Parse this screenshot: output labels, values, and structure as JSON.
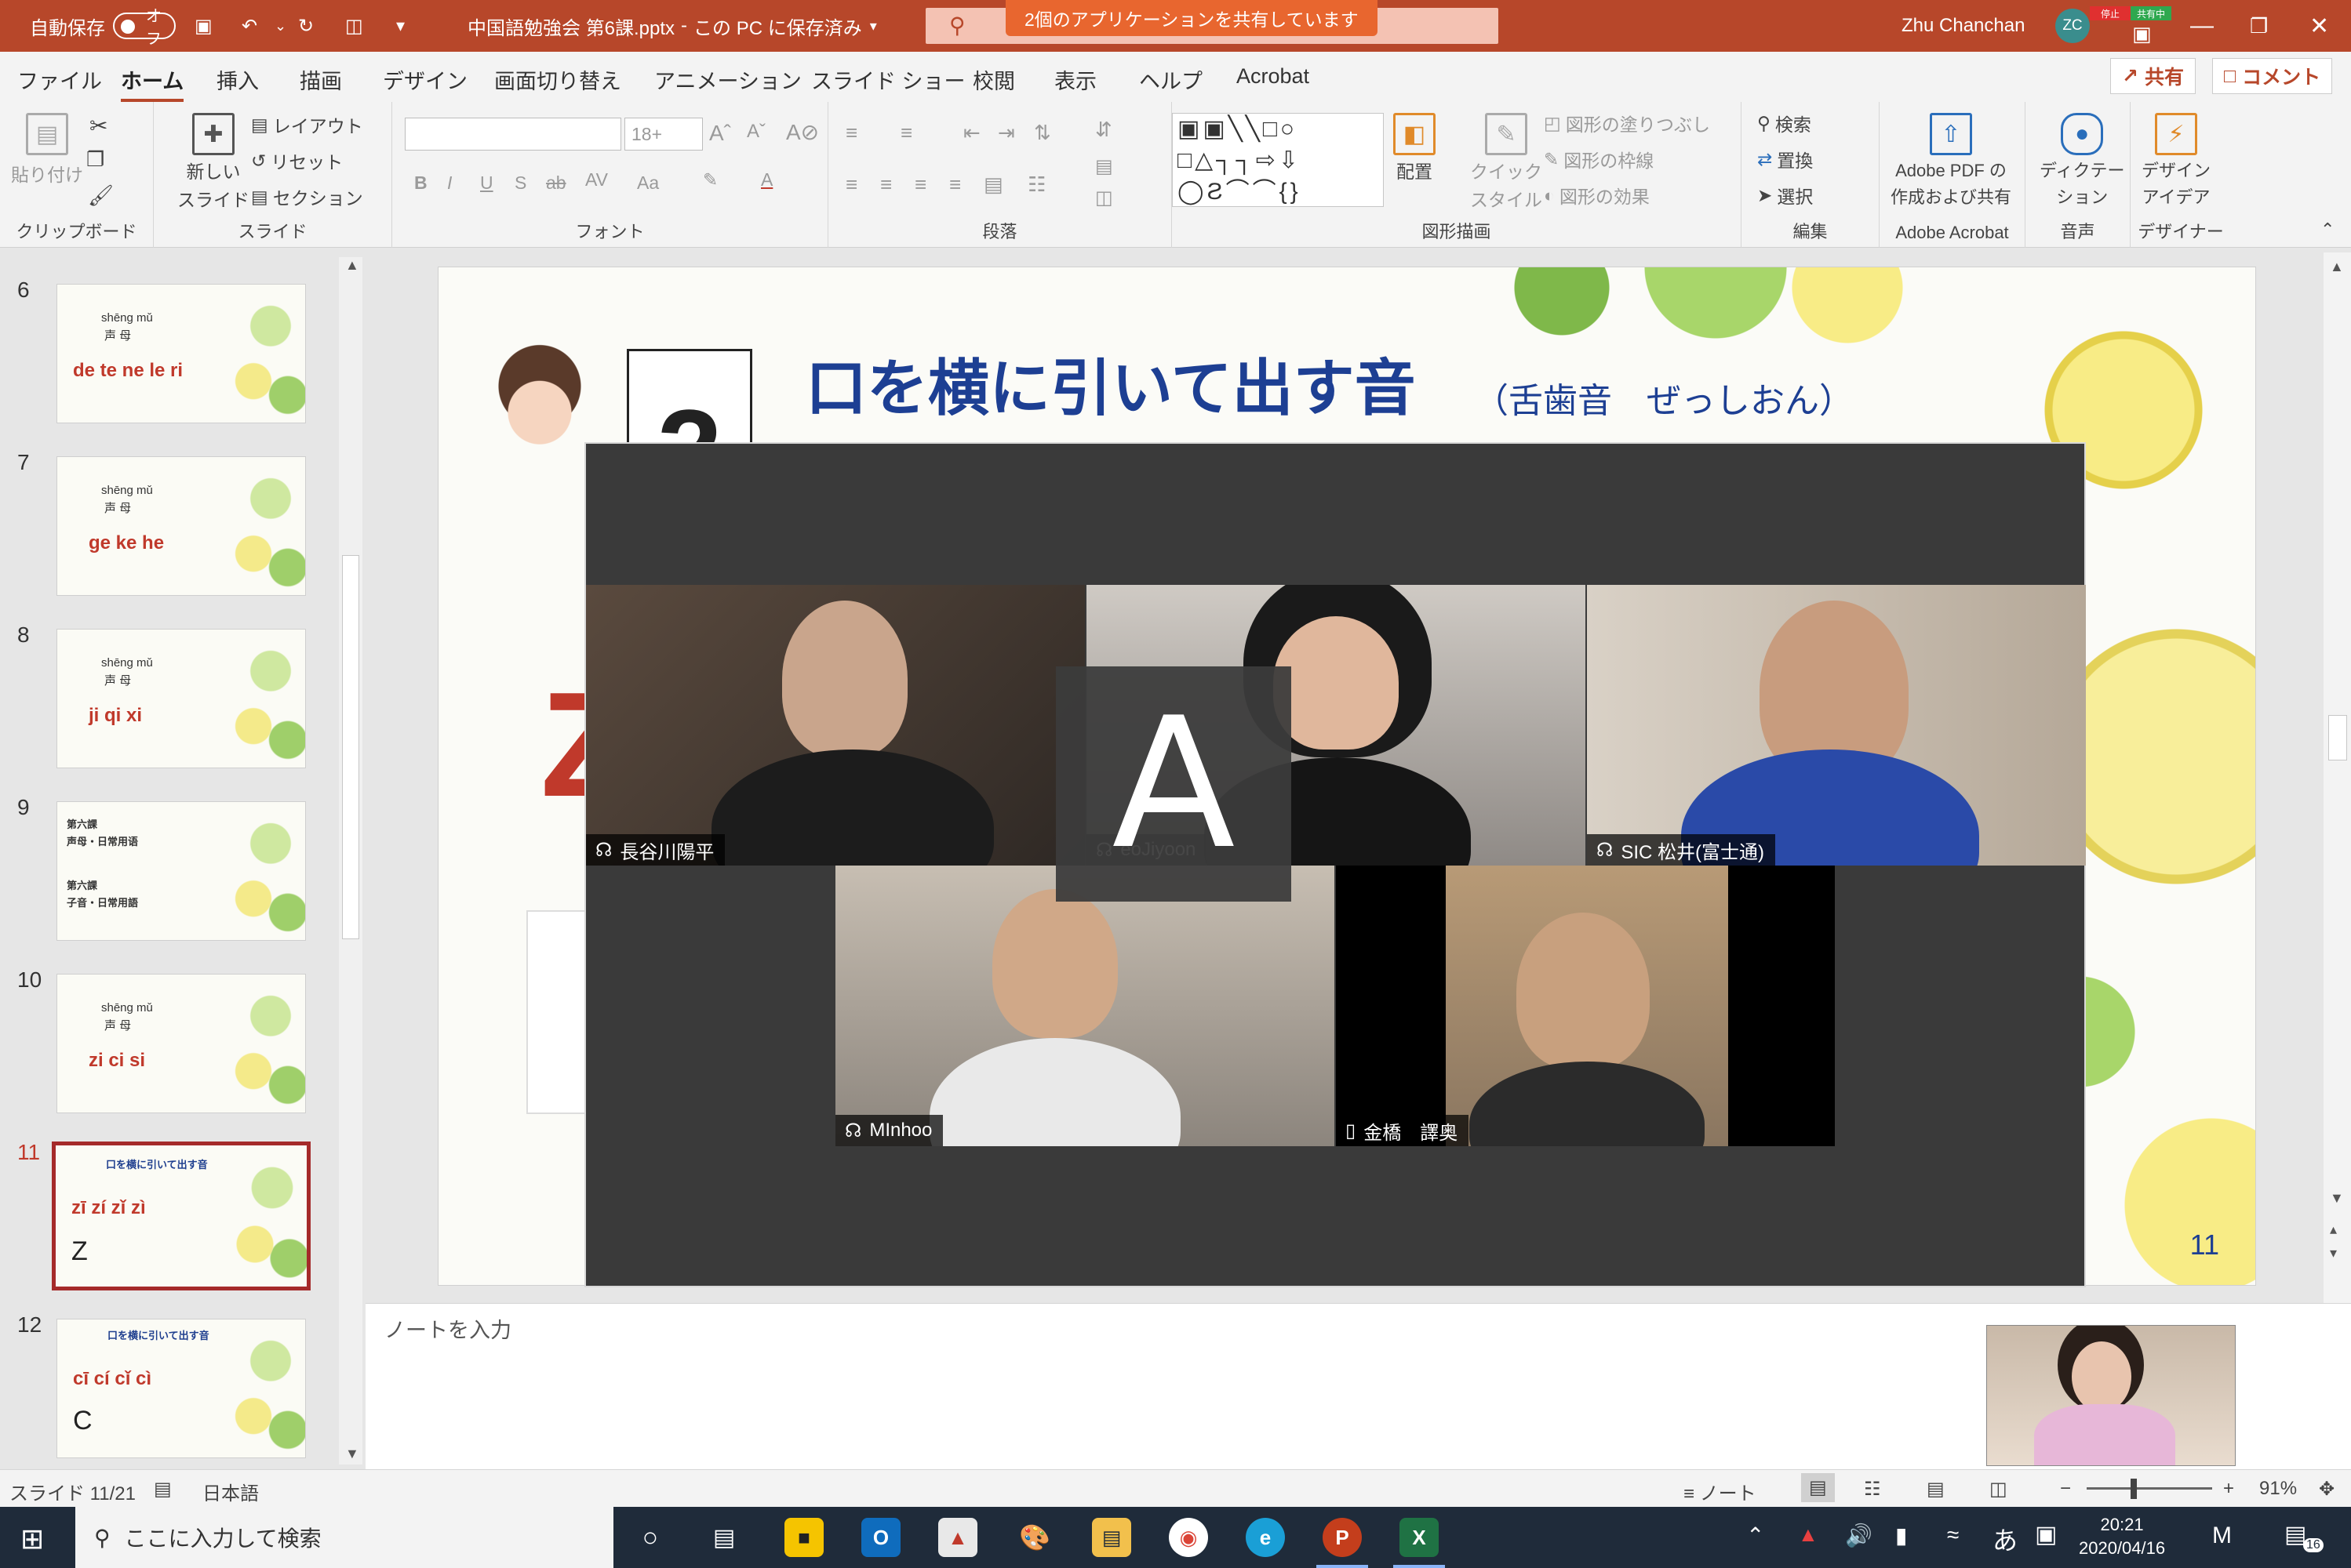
{
  "titlebar": {
    "autosave_label": "自動保存",
    "autosave_state": "オフ",
    "document_title": "中国語勉強会 第6課.pptx",
    "save_status": "この PC に保存済み",
    "share_banner": "2個のアプリケーションを共有しています",
    "user_name": "Zhu Chanchan",
    "user_initials": "ZC",
    "badge_stop": "停止",
    "badge_sharing": "共有中"
  },
  "menu": {
    "tabs": [
      "ファイル",
      "ホーム",
      "挿入",
      "描画",
      "デザイン",
      "画面切り替え",
      "アニメーション",
      "スライド ショー",
      "校閲",
      "表示",
      "ヘルプ",
      "Acrobat"
    ],
    "active": "ホーム",
    "share_button": "共有",
    "comment_button": "コメント"
  },
  "ribbon": {
    "clipboard": {
      "paste": "貼り付け",
      "label": "クリップボード"
    },
    "slides": {
      "new_slide": "新しい",
      "new_slide_2": "スライド",
      "layout": "レイアウト",
      "reset": "リセット",
      "section": "セクション",
      "label": "スライド"
    },
    "font": {
      "font_size": "18+",
      "label": "フォント"
    },
    "paragraph": {
      "label": "段落"
    },
    "drawing": {
      "arrange": "配置",
      "quick_style": "クイック",
      "quick_style_2": "スタイル",
      "fill": "図形の塗りつぶし",
      "outline": "図形の枠線",
      "effects": "図形の効果",
      "label": "図形描画"
    },
    "editing": {
      "find": "検索",
      "replace": "置換",
      "select": "選択",
      "label": "編集"
    },
    "acrobat": {
      "create": "Adobe PDF の",
      "create_2": "作成および共有",
      "label": "Adobe Acrobat"
    },
    "voice": {
      "dictate": "ディクテー",
      "dictate_2": "ション",
      "label": "音声"
    },
    "designer": {
      "ideas": "デザイン",
      "ideas_2": "アイデア",
      "label": "デザイナー"
    }
  },
  "thumbnails": [
    {
      "num": "6",
      "top_text": "shēng  mǔ",
      "sub_text": "声  母",
      "red": "de  te  ne  le  ri"
    },
    {
      "num": "7",
      "top_text": "shēng  mǔ",
      "sub_text": "声  母",
      "red": "ge    ke    he"
    },
    {
      "num": "8",
      "top_text": "shēng  mǔ",
      "sub_text": "声  母",
      "red": "ji    qi    xi"
    },
    {
      "num": "9",
      "line1": "第六課",
      "line2": "声母・日常用语",
      "line3": "第六課",
      "line4": "子音・日常用語"
    },
    {
      "num": "10",
      "top_text": "shēng  mǔ",
      "sub_text": "声  母",
      "red": "zi    ci    si"
    },
    {
      "num": "11",
      "title": "口を横に引いて出す音",
      "red": "zī  zí  zǐ  zì",
      "letter": "Z",
      "selected": true
    },
    {
      "num": "12",
      "title": "口を横に引いて出す音",
      "red": "cī  cí  cǐ  cì",
      "letter": "C"
    }
  ],
  "slide": {
    "title": "口を横に引いて出す音",
    "subtitle": "（舌歯音　ぜっしおん）",
    "number_glyph": "2",
    "big_letter": "Z",
    "page_number": "11"
  },
  "zoom": {
    "share_initial": "A",
    "participants": [
      {
        "name": "長谷川陽平",
        "icon": "headset-icon"
      },
      {
        "name": "eoJiyoon",
        "icon": "headset-icon"
      },
      {
        "name": "SIC 松井(富士通)",
        "icon": "headset-icon"
      },
      {
        "name": "MInhoo",
        "icon": "headset-icon"
      },
      {
        "name": "金橋　譯奥",
        "icon": "phone-icon"
      }
    ]
  },
  "notes": {
    "placeholder": "ノートを入力"
  },
  "status": {
    "slide_count": "スライド 11/21",
    "language": "日本語",
    "notes_button": "ノート",
    "zoom_level": "91%"
  },
  "taskbar": {
    "search_placeholder": "ここに入力して検索",
    "ime": "あ",
    "time": "20:21",
    "date": "2020/04/16",
    "notification_count": "16"
  }
}
